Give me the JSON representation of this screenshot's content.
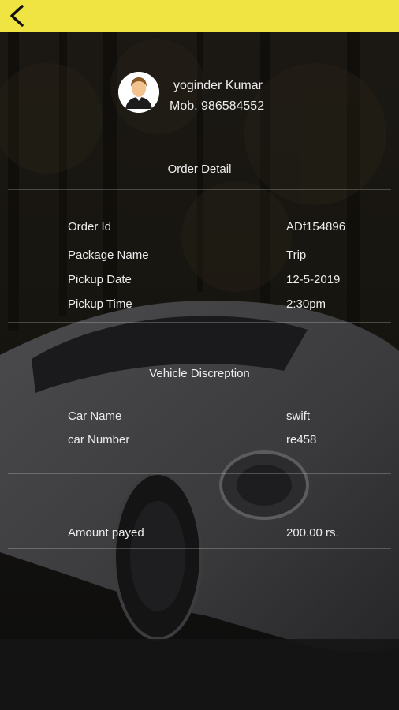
{
  "user": {
    "name": "yoginder Kumar",
    "mobile": "Mob. 986584552"
  },
  "order": {
    "title": "Order Detail",
    "rows": [
      {
        "label": "Order Id",
        "value": "ADf154896"
      },
      {
        "label": "Package Name",
        "value": "Trip"
      },
      {
        "label": "Pickup Date",
        "value": "12-5-2019"
      },
      {
        "label": "Pickup Time",
        "value": "2:30pm"
      }
    ]
  },
  "vehicle": {
    "title": "Vehicle Discreption",
    "rows": [
      {
        "label": "Car Name",
        "value": "swift"
      },
      {
        "label": "car Number",
        "value": "re458"
      }
    ]
  },
  "payment": {
    "label": "Amount payed",
    "value": "200.00 rs."
  },
  "icons": {
    "back": "chevron-left-icon",
    "avatar": "user-avatar-icon"
  },
  "colors": {
    "topbar": "#f0e443",
    "text": "#ececec",
    "background": "#121212"
  }
}
